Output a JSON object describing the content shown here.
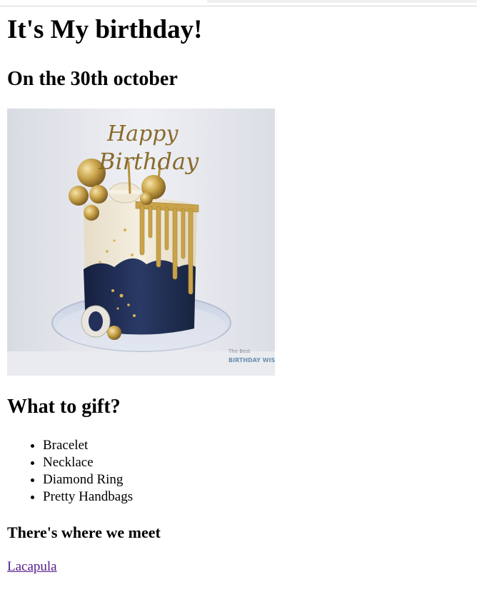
{
  "page": {
    "title": "It's My birthday!",
    "date_heading": "On the 30th october",
    "cake_image": {
      "topper_line1": "Happy",
      "topper_line2": "Birthday",
      "watermark_line1": "The Best",
      "watermark_line2": "BIRTHDAY WISHES",
      "icon": "birthday-cake-photo"
    },
    "gift_heading": "What to gift?",
    "gifts": [
      "Bracelet",
      "Necklace",
      "Diamond Ring",
      "Pretty Handbags"
    ],
    "meet_heading": "There's where we meet",
    "meet_link": "Lacapula"
  },
  "colors": {
    "link_visited": "#551a8b",
    "cake_navy": "#1f2b4f",
    "cake_cream": "#efe6d4",
    "gold": "#c9a34a"
  }
}
